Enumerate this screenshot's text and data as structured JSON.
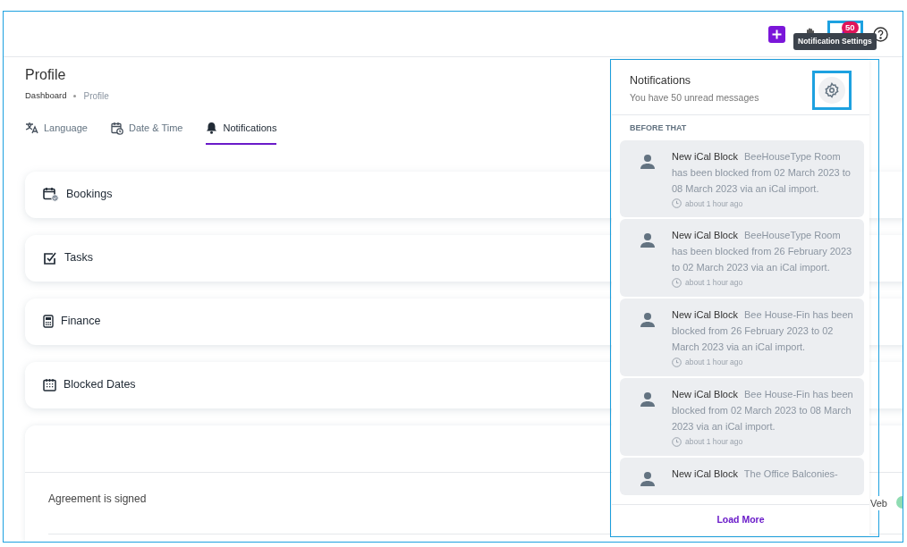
{
  "header": {
    "badge_count": "50",
    "tooltip": "Notification Settings"
  },
  "page": {
    "title": "Profile",
    "breadcrumbs": [
      "Dashboard",
      "Profile"
    ]
  },
  "tabs": [
    {
      "label": "Language",
      "kind": "language",
      "selected": false
    },
    {
      "label": "Date & Time",
      "kind": "datetime",
      "selected": false
    },
    {
      "label": "Notifications",
      "kind": "bell",
      "selected": true
    }
  ],
  "sections": [
    {
      "label": "Bookings",
      "kind": "bookings"
    },
    {
      "label": "Tasks",
      "kind": "tasks"
    },
    {
      "label": "Finance",
      "kind": "finance"
    },
    {
      "label": "Blocked Dates",
      "kind": "blocked"
    }
  ],
  "agreement_row": {
    "label": "Agreement is signed",
    "column_2": "Veb"
  },
  "notifications": {
    "title": "Notifications",
    "subtitle": "You have 50 unread messages",
    "group": "BEFORE THAT",
    "items": [
      {
        "title": "New iCal Block",
        "body": "BeeHouseType Room has been blocked from 02 March 2023 to 08 March 2023 via an iCal import.",
        "time": "about 1 hour ago"
      },
      {
        "title": "New iCal Block",
        "body": "BeeHouseType Room has been blocked from 26 February 2023 to 02 March 2023 via an iCal import.",
        "time": "about 1 hour ago"
      },
      {
        "title": "New iCal Block",
        "body": "Bee House-Fin has been blocked from 26 February 2023 to 02 March 2023 via an iCal import.",
        "time": "about 1 hour ago"
      },
      {
        "title": "New iCal Block",
        "body": "Bee House-Fin has been blocked from 02 March 2023 to 08 March 2023 via an iCal import.",
        "time": "about 1 hour ago"
      },
      {
        "title": "New iCal Block",
        "body": "The Office Balconies-"
      }
    ],
    "load_more": "Load More"
  }
}
